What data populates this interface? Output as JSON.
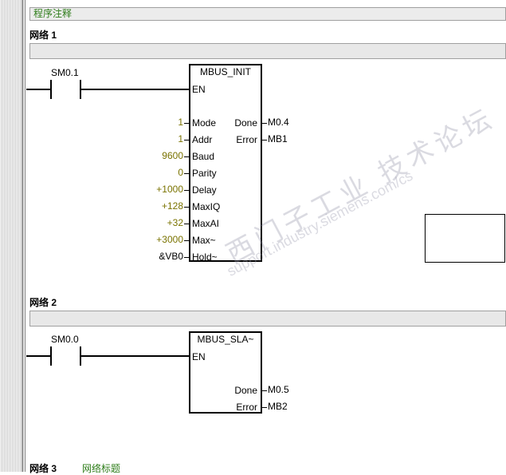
{
  "comment_bar": {
    "text": "程序注释"
  },
  "network1": {
    "title": "网络 1",
    "contact": "SM0.1",
    "block": {
      "name": "MBUS_INIT",
      "en": "EN",
      "inputs": [
        {
          "value": "1",
          "pin": "Mode"
        },
        {
          "value": "1",
          "pin": "Addr"
        },
        {
          "value": "9600",
          "pin": "Baud"
        },
        {
          "value": "0",
          "pin": "Parity"
        },
        {
          "value": "+1000",
          "pin": "Delay"
        },
        {
          "value": "+128",
          "pin": "MaxIQ"
        },
        {
          "value": "+32",
          "pin": "MaxAI"
        },
        {
          "value": "+3000",
          "pin": "Max~"
        },
        {
          "value": "&VB0",
          "pin": "Hold~"
        }
      ],
      "outputs": [
        {
          "pin": "Done",
          "value": "M0.4"
        },
        {
          "pin": "Error",
          "value": "MB1"
        }
      ]
    }
  },
  "network2": {
    "title": "网络 2",
    "contact": "SM0.0",
    "block": {
      "name": "MBUS_SLA~",
      "en": "EN",
      "outputs": [
        {
          "pin": "Done",
          "value": "M0.5"
        },
        {
          "pin": "Error",
          "value": "MB2"
        }
      ]
    }
  },
  "network3": {
    "title": "网络 3",
    "subtitle": "网络标题"
  },
  "watermark": {
    "line1": "西门子工业 技术论坛",
    "line2": "support.industry.siemens.com/cs"
  }
}
